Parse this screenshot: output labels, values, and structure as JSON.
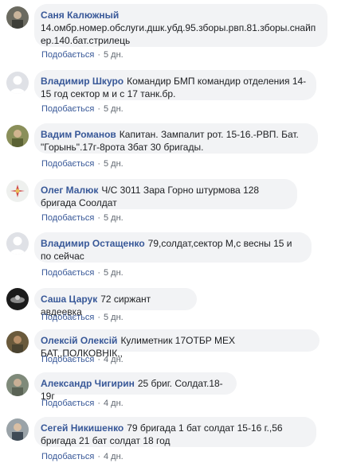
{
  "comments": [
    {
      "author": "Саня Калюжный",
      "text": "14.омбр.номер.обслуги.дшк.убд.95.зборы.рвп.81.зборы.снайпер.140.бат.стрилець",
      "like": "Подобається",
      "sep": "·",
      "time": "5 дн.",
      "avatar": "photo"
    },
    {
      "author": "Владимир Шкуро",
      "text": "Командир БМП командир отделения 14-15 год сектор м и с 17 танк.бр.",
      "like": "Подобається",
      "sep": "·",
      "time": "5 дн.",
      "avatar": "default"
    },
    {
      "author": "Вадим Романов",
      "text": "Капитан. Зампалит рот. 15-16.-РВП. Бат. \"Горынь\".17г-8рота 3бат 30 бригады.",
      "like": "Подобається",
      "sep": "·",
      "time": "5 дн.",
      "avatar": "photo"
    },
    {
      "author": "Олег Малюк",
      "text": "Ч/С 3011 Зара Горно штурмова 128 бригада Соолдат",
      "like": "Подобається",
      "sep": "·",
      "time": "5 дн.",
      "avatar": "photo"
    },
    {
      "author": "Владимир Остащенко",
      "text": "79,солдат,сектор М,с весны 15 и по сейчас",
      "like": "Подобається",
      "sep": "·",
      "time": "5 дн.",
      "avatar": "default"
    },
    {
      "author": "Саша Царук",
      "text": "72 сиржант авдеевка",
      "like": "Подобається",
      "sep": "·",
      "time": "5 дн.",
      "avatar": "photo"
    },
    {
      "author": "Олексій Олексій",
      "text": "Кулиметник 17ОТБР МЕХ БАТ,,ПОЛКОВНІК,,",
      "like": "Подобається",
      "sep": "·",
      "time": "4 дн.",
      "avatar": "photo"
    },
    {
      "author": "Александр Чигирин",
      "text": "25 бриг. Солдат.18-19г",
      "like": "Подобається",
      "sep": "·",
      "time": "4 дн.",
      "avatar": "photo"
    },
    {
      "author": "Сегей Никишенко",
      "text": "79 бригада 1 бат солдат 15-16 г.,56 бригада 21 бат солдат 18 год",
      "like": "Подобається",
      "sep": "·",
      "time": "4 дн.",
      "avatar": "photo"
    }
  ],
  "colors": {
    "link": "#385898",
    "bubble": "#f2f3f5",
    "meta": "#606770",
    "text": "#1c1e21"
  }
}
